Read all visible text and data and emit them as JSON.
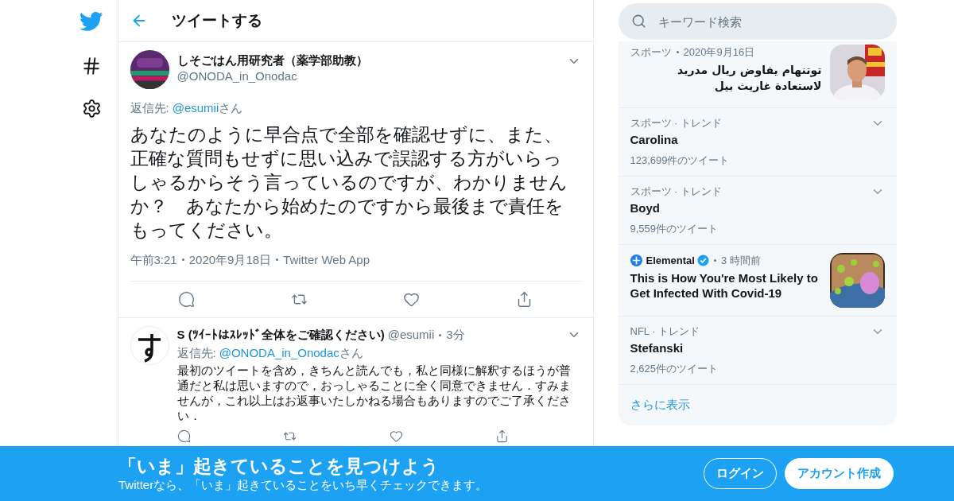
{
  "header": {
    "title": "ツイートする"
  },
  "main_tweet": {
    "name": "しそごはん用研究者（薬学部助教）",
    "handle": "@ONODA_in_Onodac",
    "reply_label": "返信先:",
    "reply_to": "@esumii",
    "reply_suffix": "さん",
    "text": "あなたのように早合点で全部を確認せずに、また、正確な質問もせずに思い込みで誤認する方がいらっしゃるからそう言っているのですが、わかりませんか？　あなたから始めたのですから最後まで責任をもってください。",
    "meta": [
      "午前3:21",
      "2020年9月18日",
      "Twitter Web App"
    ]
  },
  "reply_tweet": {
    "name": "S (ﾂｲｰﾄはｽﾚｯﾄﾞ全体をご確認ください)",
    "handle": "@esumii",
    "time": "3分",
    "reply_label": "返信先:",
    "reply_to": "@ONODA_in_Onodac",
    "reply_suffix": "さん",
    "text": "最初のツイートを含め，きちんと読んでも，私と同様に解釈するほうが普通だと私は思いますので，おっしゃることに全く同意できません．すみませんが，これ以上はお返事いたしかねる場合もありますのでご了承ください．"
  },
  "search": {
    "placeholder": "キーワード検索"
  },
  "trends": [
    {
      "kind": "news",
      "category": "スポーツ",
      "time": "2020年9月16日",
      "headline": "توتنهام يفاوض ريال مدريد لاستعادة غاريث بيل"
    },
    {
      "kind": "trend",
      "category": "スポーツ · トレンド",
      "name": "Carolina",
      "count": "123,699件のツイート"
    },
    {
      "kind": "trend",
      "category": "スポーツ · トレンド",
      "name": "Boyd",
      "count": "9,559件のツイート"
    },
    {
      "kind": "account_news",
      "source": "Elemental",
      "verified": true,
      "time": "3 時間前",
      "headline": "This is How You're Most Likely to Get Infected With Covid-19"
    },
    {
      "kind": "trend",
      "category": "NFL · トレンド",
      "name": "Stefanski",
      "count": "2,625件のツイート"
    }
  ],
  "show_more": "さらに表示",
  "banner": {
    "title": "「いま」起きていることを見つけよう",
    "subtitle": "Twitterなら、「いま」起きていることをいち早くチェックできます。",
    "buttons": [
      {
        "label": "ログイン",
        "kind": "outline"
      },
      {
        "label": "アカウント作成",
        "kind": "filled"
      }
    ]
  }
}
